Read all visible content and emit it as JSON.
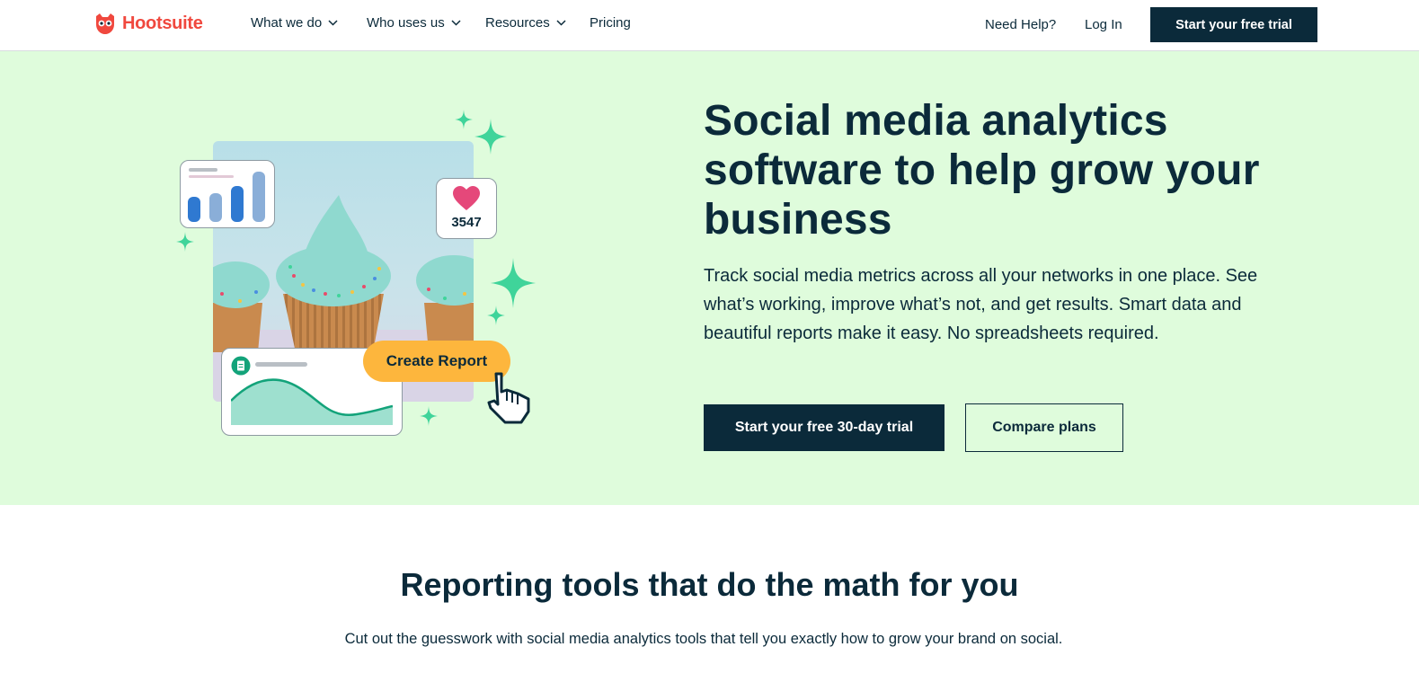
{
  "nav": {
    "logo_text": "Hootsuite",
    "items": [
      {
        "label": "What we do",
        "dropdown": true
      },
      {
        "label": "Who uses us",
        "dropdown": true
      },
      {
        "label": "Resources",
        "dropdown": true
      },
      {
        "label": "Pricing",
        "dropdown": false
      }
    ],
    "help_label": "Need Help?",
    "login_label": "Log In",
    "cta_label": "Start your free trial"
  },
  "hero": {
    "title": "Social media analytics software to help grow your business",
    "subtitle": "Track social media metrics across all your networks in one place. See what’s working, improve what’s not, and get results. Smart data and beautiful reports make it easy. No spreadsheets required.",
    "primary_button": "Start your free 30-day trial",
    "secondary_button": "Compare plans",
    "illustration": {
      "like_count": "3547",
      "create_report_label": "Create Report",
      "icons": [
        "bar-chart-icon",
        "heart-icon",
        "document-icon",
        "pointer-hand-icon",
        "sparkle-icon"
      ]
    }
  },
  "section": {
    "title": "Reporting tools that do the math for you",
    "subtitle": "Cut out the guesswork with social media analytics tools that tell you exactly how to grow your brand on social."
  },
  "colors": {
    "brand": "#f0483e",
    "navy": "#0b2a3a",
    "hero_bg": "#dffcdc",
    "accent_green": "#3fd49a",
    "accent_yellow": "#fdb63d",
    "heart": "#e5487a"
  }
}
